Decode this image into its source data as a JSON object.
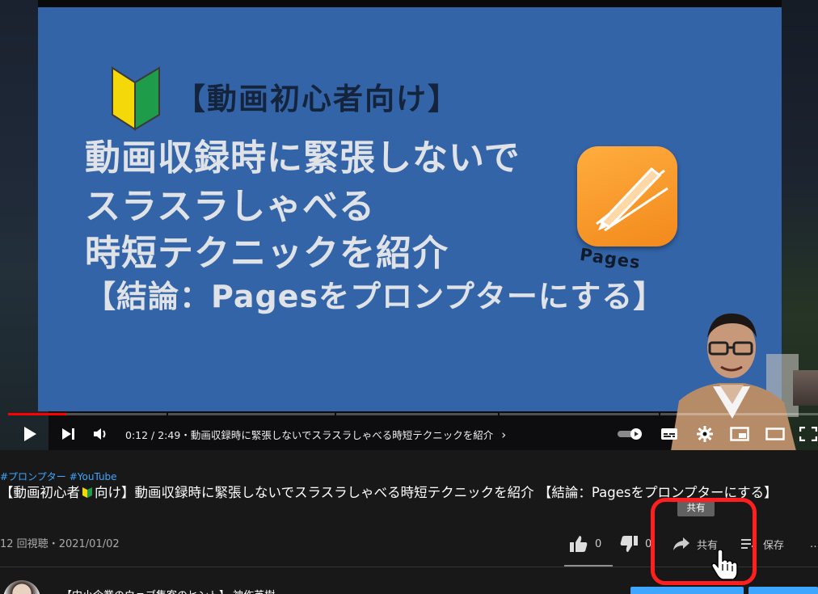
{
  "player": {
    "slide": {
      "line1": "【動画初心者向け】",
      "line2": "動画収録時に緊張しないで",
      "line3": "スラスラしゃべる",
      "line4": "時短テクニックを紹介",
      "line5": "【結論：Pagesをプロンプターにする】",
      "app_label": "Pages"
    },
    "progress_fraction": 0.072,
    "time": "0:12 / 2:49",
    "chapter_separator": "・",
    "chapter": "動画収録時に緊張しないでスラスラしゃべる時短テクニックを紹介",
    "chapter_chevron": "›",
    "icons": [
      "play-icon",
      "next-icon",
      "volume-icon",
      "autoplay-toggle-icon",
      "subtitles-icon",
      "settings-gear-icon",
      "miniplayer-icon",
      "theater-mode-icon",
      "fullscreen-icon"
    ]
  },
  "video": {
    "hashtags": [
      "#プロンプター",
      "#YouTube"
    ],
    "title_part1": "【動画初心者",
    "title_part2": "向け】動画収録時に緊張しないでスラスラしゃべる時短テクニックを紹介 【結論：Pagesをプロンプターにする】",
    "views": "12 回視聴",
    "meta_separator": "・",
    "date": "2021/01/02"
  },
  "actions": {
    "like_count": "0",
    "dislike_count": "0",
    "share_label": "共有",
    "save_label": "保存",
    "more_label": "…",
    "tooltip": "共有"
  },
  "channel": {
    "name": "【中小企業のウェブ集客のヒント】 神作英樹"
  },
  "colors": {
    "slide_bg": "#3364a8",
    "progress": "#ff0000",
    "hashtag": "#3ea6ff",
    "highlight": "#ff1f1f"
  }
}
